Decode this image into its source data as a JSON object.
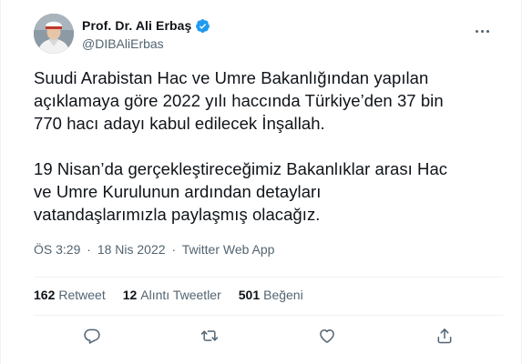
{
  "author": {
    "display_name": "Prof. Dr. Ali Erbaş",
    "handle": "@DIBAliErbas",
    "verified": true,
    "avatar_icon": "profile-photo"
  },
  "tweet": {
    "lines_para1": [
      "Suudi Arabistan Hac ve Umre Bakanlığından yapılan",
      "açıklamaya göre 2022 yılı haccında Türkiye’den 37 bin",
      "770 hacı adayı kabul edilecek İnşallah."
    ],
    "lines_para2": [
      "19 Nisan’da gerçekleştireceğimiz Bakanlıklar arası Hac",
      "ve Umre Kurulunun ardından detayları",
      "vatandaşlarımızla paylaşmış olacağız."
    ]
  },
  "meta": {
    "time": "ÖS 3:29",
    "separator": "·",
    "date": "18 Nis 2022",
    "source": "Twitter Web App"
  },
  "stats": {
    "retweets": {
      "count": "162",
      "label": "Retweet"
    },
    "quotes": {
      "count": "12",
      "label": "Alıntı Tweetler"
    },
    "likes": {
      "count": "501",
      "label": "Beğeni"
    }
  },
  "actions": [
    "reply-icon",
    "retweet-icon",
    "like-icon",
    "share-icon"
  ],
  "colors": {
    "text": "#0f1419",
    "secondary": "#536471",
    "divider": "#eff3f4",
    "verified": "#1d9bf0"
  }
}
